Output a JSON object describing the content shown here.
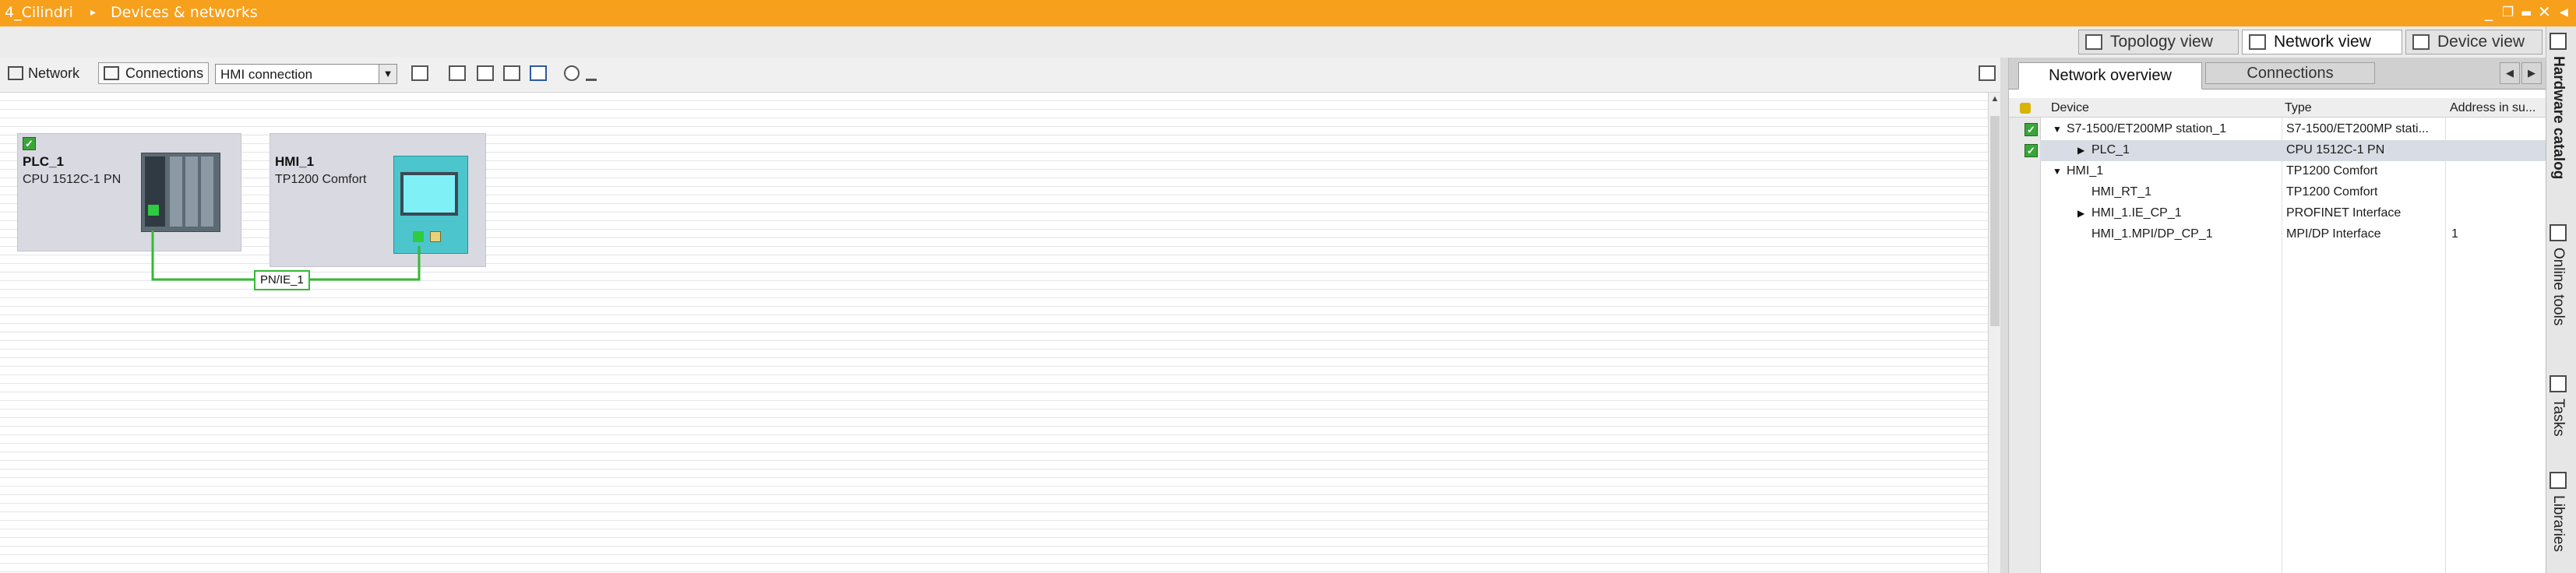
{
  "titlebar": {
    "project": "4_Cilindri",
    "separator": "▸",
    "section": "Devices & networks",
    "minimize_glyph": "_",
    "restore_glyph": "❐",
    "maximize_glyph": "▬",
    "close_glyph": "✕",
    "collapse_glyph": "◀",
    "bg_color": "#f7a01c"
  },
  "view_tabs": [
    {
      "label": "Topology view",
      "icon": "topology-icon",
      "active": false
    },
    {
      "label": "Network view",
      "icon": "network-icon",
      "active": true
    },
    {
      "label": "Device view",
      "icon": "device-icon",
      "active": false
    }
  ],
  "toolbar": {
    "network_label": "Network",
    "connections_label": "Connections",
    "connection_type": "HMI connection",
    "dropdown_glyph": "▼"
  },
  "network": {
    "plc": {
      "name": "PLC_1",
      "type": "CPU 1512C-1 PN"
    },
    "hmi": {
      "name": "HMI_1",
      "type": "TP1200 Comfort"
    },
    "subnet_label": "PN/IE_1",
    "link_color": "#33bb33"
  },
  "overview": {
    "tabs": [
      "Network overview",
      "Connections"
    ],
    "nav_prev": "◀",
    "nav_next": "▶",
    "columns": [
      "Device",
      "Type",
      "Address in su..."
    ],
    "rows": [
      {
        "expander": "▼",
        "checked": true,
        "device": "S7-1500/ET200MP station_1",
        "type": "S7-1500/ET200MP stati...",
        "address": ""
      },
      {
        "expander": "▶",
        "checked": true,
        "device": "PLC_1",
        "type": "CPU 1512C-1 PN",
        "address": ""
      },
      {
        "expander": "▼",
        "checked": false,
        "device": "HMI_1",
        "type": "TP1200 Comfort",
        "address": ""
      },
      {
        "expander": "",
        "checked": false,
        "device": "HMI_RT_1",
        "type": "TP1200 Comfort",
        "address": ""
      },
      {
        "expander": "▶",
        "checked": false,
        "device": "HMI_1.IE_CP_1",
        "type": "PROFINET Interface",
        "address": ""
      },
      {
        "expander": "",
        "checked": false,
        "device": "HMI_1.MPI/DP_CP_1",
        "type": "MPI/DP Interface",
        "address": "1"
      }
    ]
  },
  "side_tabs": [
    "Hardware catalog",
    "Online tools",
    "Tasks",
    "Libraries"
  ],
  "colors": {
    "accent": "#f7a01c",
    "canvas_line": "#e4e4ec",
    "station_bg": "#d9d9e1",
    "hmi_device": "#4cc6cc",
    "check": "#3aa63a"
  }
}
